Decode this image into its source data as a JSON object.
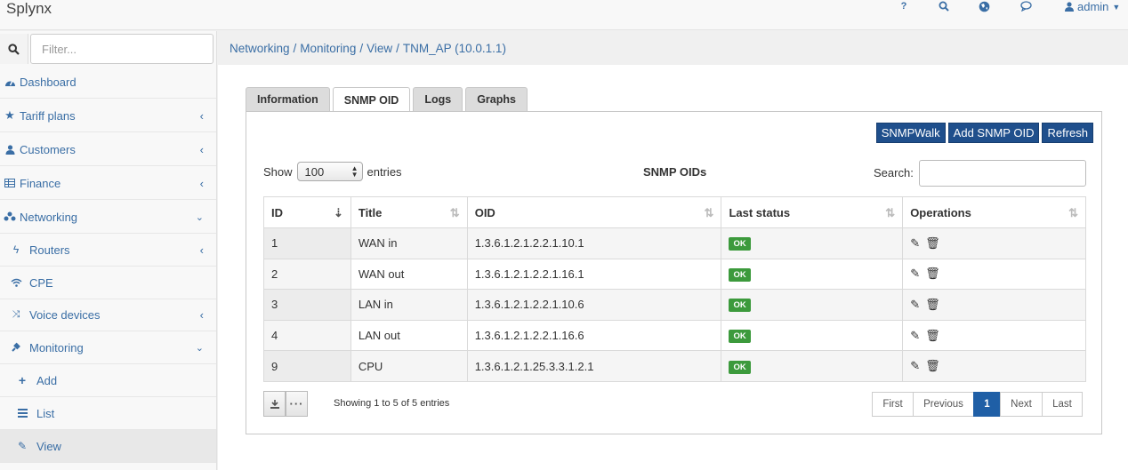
{
  "app": {
    "title": "Splynx"
  },
  "topbar": {
    "help": "?",
    "user": "admin"
  },
  "sidebar": {
    "filter_placeholder": "Filter...",
    "items": [
      {
        "label": "Dashboard",
        "icon": "dashboard-icon"
      },
      {
        "label": "Tariff plans",
        "icon": "star-icon"
      },
      {
        "label": "Customers",
        "icon": "user-icon"
      },
      {
        "label": "Finance",
        "icon": "table-icon"
      },
      {
        "label": "Networking",
        "icon": "sitemap-icon"
      },
      {
        "label": "Routers",
        "icon": "bolt-icon"
      },
      {
        "label": "CPE",
        "icon": "wifi-icon"
      },
      {
        "label": "Voice devices",
        "icon": "shuffle-icon"
      },
      {
        "label": "Monitoring",
        "icon": "plug-icon"
      },
      {
        "label": "Add",
        "icon": "plus-icon"
      },
      {
        "label": "List",
        "icon": "list-icon"
      },
      {
        "label": "View",
        "icon": "pencil-icon"
      }
    ]
  },
  "breadcrumb": [
    "Networking",
    "Monitoring",
    "View",
    "TNM_AP (10.0.1.1)"
  ],
  "tabs": [
    "Information",
    "SNMP OID",
    "Logs",
    "Graphs"
  ],
  "toolbar": {
    "snmpwalk": "SNMPWalk",
    "add": "Add SNMP OID",
    "refresh": "Refresh"
  },
  "table_controls": {
    "show": "Show",
    "page_size": "100",
    "entries": "entries",
    "title": "SNMP OIDs",
    "search_label": "Search:"
  },
  "columns": [
    "ID",
    "Title",
    "OID",
    "Last status",
    "Operations"
  ],
  "rows": [
    {
      "id": "1",
      "title": "WAN in",
      "oid": "1.3.6.1.2.1.2.2.1.10.1",
      "status": "OK"
    },
    {
      "id": "2",
      "title": "WAN out",
      "oid": "1.3.6.1.2.1.2.2.1.16.1",
      "status": "OK"
    },
    {
      "id": "3",
      "title": "LAN in",
      "oid": "1.3.6.1.2.1.2.2.1.10.6",
      "status": "OK"
    },
    {
      "id": "4",
      "title": "LAN out",
      "oid": "1.3.6.1.2.1.2.2.1.16.6",
      "status": "OK"
    },
    {
      "id": "9",
      "title": "CPU",
      "oid": "1.3.6.1.2.1.25.3.3.1.2.1",
      "status": "OK"
    }
  ],
  "footer": {
    "info": "Showing 1 to 5 of 5 entries",
    "pager": {
      "first": "First",
      "previous": "Previous",
      "current": "1",
      "next": "Next",
      "last": "Last"
    }
  },
  "colors": {
    "link": "#3a6ea5",
    "primary_button": "#1f4f8c",
    "ok_badge": "#3c9a3c",
    "pager_active": "#1f5fa6"
  }
}
